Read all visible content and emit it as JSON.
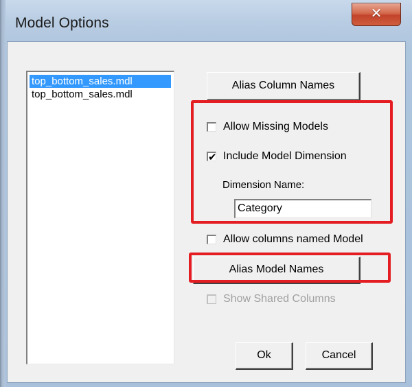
{
  "window": {
    "title": "Model Options",
    "close_glyph": "✕",
    "frame_color": "#b4c7dd",
    "close_color": "#c2432a"
  },
  "models_list": {
    "items": [
      {
        "label": "top_bottom_sales.mdl",
        "selected": true
      },
      {
        "label": "top_bottom_sales.mdl",
        "selected": false
      }
    ],
    "selected_color": "#3399ff"
  },
  "buttons": {
    "alias_column_names": "Alias Column Names",
    "alias_model_names": "Alias Model Names",
    "ok": "Ok",
    "cancel": "Cancel"
  },
  "options": {
    "allow_missing_models": {
      "label": "Allow Missing Models",
      "checked": false
    },
    "include_model_dimension": {
      "label": "Include Model Dimension",
      "checked": true
    },
    "dimension_name_label": "Dimension Name:",
    "dimension_name_value": "Category",
    "allow_columns_named_model": {
      "label": "Allow columns named Model",
      "checked": false
    },
    "show_shared_columns": {
      "label": "Show Shared Columns",
      "checked": false,
      "disabled": true
    }
  },
  "annotation_color": "#e41d22",
  "icons": {
    "check": "✔"
  }
}
